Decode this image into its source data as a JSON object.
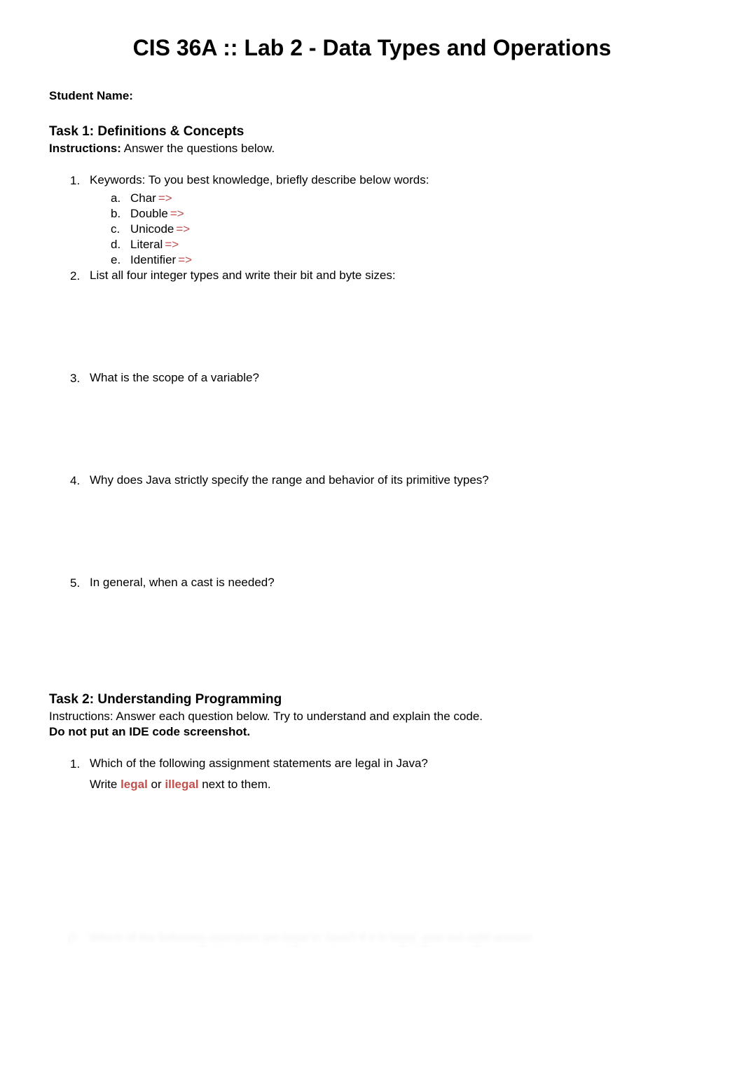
{
  "title": "CIS 36A :: Lab 2 - Data Types and Operations",
  "student_name_label": "Student Name:",
  "task1": {
    "heading": "Task 1: Definitions & Concepts",
    "instructions_label": "Instructions:",
    "instructions_text": " Answer the questions below.",
    "q1": {
      "number": "1.",
      "text": "Keywords: To you best knowledge, briefly describe below words:",
      "items": [
        {
          "letter": "a.",
          "text": "Char ",
          "arrow": "=>"
        },
        {
          "letter": "b.",
          "text": "Double ",
          "arrow": "=>"
        },
        {
          "letter": "c.",
          "text": "Unicode ",
          "arrow": "=>"
        },
        {
          "letter": "d.",
          "text": "Literal ",
          "arrow": "=>"
        },
        {
          "letter": "e.",
          "text": "Identifier ",
          "arrow": "=>"
        }
      ]
    },
    "q2": {
      "number": "2.",
      "text": "List all four integer types and write their bit and byte sizes:"
    },
    "q3": {
      "number": "3.",
      "text": "What is the scope of a variable?"
    },
    "q4": {
      "number": "4.",
      "text": "Why does Java strictly specify the range and behavior of its primitive types?"
    },
    "q5": {
      "number": "5.",
      "text": "In general, when a cast is needed?"
    }
  },
  "task2": {
    "heading": "Task 2: Understanding Programming",
    "instructions": "Instructions: Answer each question below. Try to understand and explain the code.",
    "bold_note": "Do not put an IDE code screenshot.",
    "q1": {
      "number": "1.",
      "text": "Which of the following assignment statements are legal in Java?",
      "line2_pre": "Write ",
      "legal": "legal",
      "or": " or ",
      "illegal": "illegal",
      "line2_post": " next to them."
    },
    "q2_faded": {
      "number": "2.",
      "text": "Which of the following operators are legal in Java? If it is legal, give out right answer."
    }
  }
}
